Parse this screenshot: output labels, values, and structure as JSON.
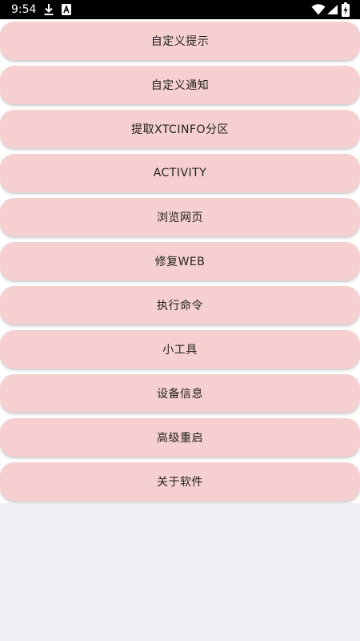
{
  "status_bar": {
    "time": "9:54",
    "icons": [
      "download-icon",
      "app-notification-icon",
      "wifi-icon",
      "cell-signal-icon",
      "battery-charging-icon"
    ]
  },
  "menu": {
    "items": [
      {
        "label": "自定义提示"
      },
      {
        "label": "自定义通知"
      },
      {
        "label": "提取XTCINFO分区"
      },
      {
        "label": "ACTIVITY"
      },
      {
        "label": "浏览网页"
      },
      {
        "label": "修复WEB"
      },
      {
        "label": "执行命令"
      },
      {
        "label": "小工具"
      },
      {
        "label": "设备信息"
      },
      {
        "label": "高级重启"
      },
      {
        "label": "关于软件"
      }
    ]
  },
  "colors": {
    "status_bar_bg": "#000000",
    "item_bg": "#f6d0d0",
    "list_bg": "#ffffff",
    "page_bg": "#f0eef3"
  }
}
